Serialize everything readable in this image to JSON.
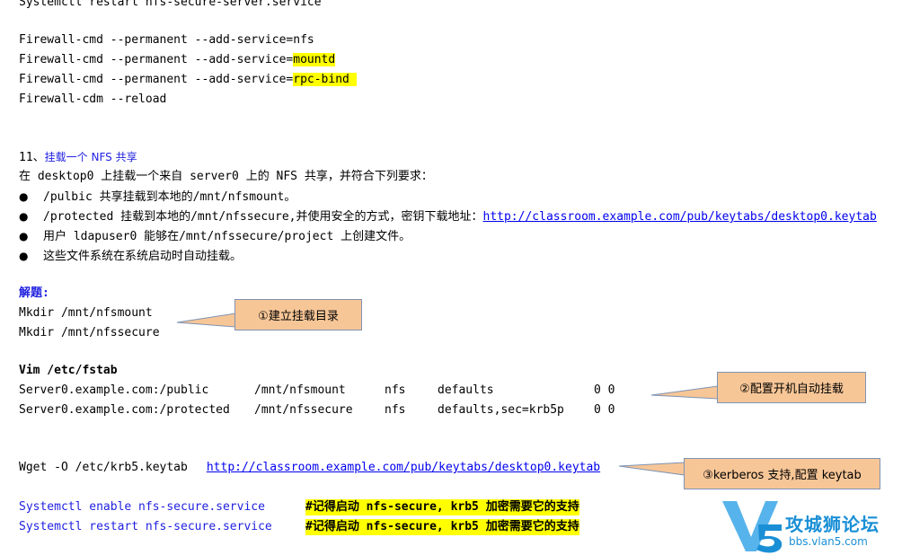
{
  "top_line": "Systemctl restart nfs-secure-server.service",
  "firewall": {
    "line1": "Firewall-cmd --permanent --add-service=nfs",
    "line2_prefix": "Firewall-cmd --permanent --add-service=",
    "line2_hl": "mountd",
    "line3_prefix": "Firewall-cmd --permanent --add-service=",
    "line3_hl": "rpc-bind ",
    "line4": "Firewall-cdm --reload"
  },
  "section": {
    "number": "11、",
    "title": "挂载一个 NFS 共享",
    "intro": "在 desktop0 上挂载一个来自 server0 上的 NFS 共享，并符合下列要求：",
    "bullets": [
      "/pulbic 共享挂载到本地的/mnt/nfsmount。",
      "/protected 挂载到本地的/mnt/nfssecure,并使用安全的方式，密钥下载地址：",
      "用户 ldapuser0 能够在/mnt/nfssecure/project 上创建文件。",
      "这些文件系统在系统启动时自动挂载。"
    ],
    "bullet2_link": "http://classroom.example.com/pub/keytabs/desktop0.keytab"
  },
  "solution": {
    "label": "解题:",
    "mkdir1": "Mkdir /mnt/nfsmount",
    "mkdir2": "Mkdir /mnt/nfssecure",
    "vim": "Vim /etc/fstab",
    "fstab": [
      {
        "src": "Server0.example.com:/public",
        "mnt": "/mnt/nfsmount",
        "type": "nfs",
        "opts": "defaults",
        "dump": "0 0"
      },
      {
        "src": "Server0.example.com:/protected",
        "mnt": "/mnt/nfssecure",
        "type": "nfs",
        "opts": "defaults,sec=krb5p",
        "dump": "0 0"
      }
    ],
    "wget_cmd": "Wget -O /etc/krb5.keytab",
    "wget_url": "http://classroom.example.com/pub/keytabs/desktop0.keytab",
    "enable_cmd": "Systemctl enable nfs-secure.service",
    "restart_cmd": "Systemctl restart nfs-secure.service",
    "note": "#记得启动 nfs-secure, krb5 加密需要它的支持"
  },
  "callouts": {
    "c1": "①建立挂载目录",
    "c2": "②配置开机自动挂载",
    "c3": "③kerberos 支持,配置 keytab"
  },
  "watermark": {
    "title": "攻城狮论坛",
    "url": "bbs.vlan5.com"
  },
  "colors": {
    "highlight": "#ffff00",
    "blue_text": "#1f1fe0",
    "callout_fill": "#f7c697",
    "callout_border": "#7f93b3",
    "watermark": "#1a8fd6"
  }
}
